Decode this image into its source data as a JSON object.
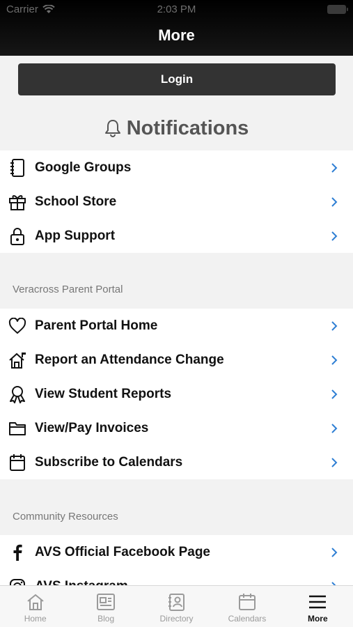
{
  "status_bar": {
    "carrier": "Carrier",
    "time": "2:03 PM"
  },
  "nav": {
    "title": "More"
  },
  "login_label": "Login",
  "notifications_label": "Notifications",
  "group1": [
    {
      "label": "Google Groups",
      "icon": "notebook-icon"
    },
    {
      "label": "School Store",
      "icon": "gift-icon"
    },
    {
      "label": "App Support",
      "icon": "lock-icon"
    }
  ],
  "section_veracross": "Veracross Parent Portal",
  "group2": [
    {
      "label": "Parent Portal Home",
      "icon": "heart-icon"
    },
    {
      "label": "Report an Attendance Change",
      "icon": "house-flag-icon"
    },
    {
      "label": "View Student Reports",
      "icon": "ribbon-icon"
    },
    {
      "label": "View/Pay Invoices",
      "icon": "folder-icon"
    },
    {
      "label": "Subscribe to Calendars",
      "icon": "calendar-icon"
    }
  ],
  "section_community": "Community Resources",
  "group3": [
    {
      "label": "AVS Official Facebook Page",
      "icon": "facebook-icon"
    },
    {
      "label": "AVS Instagram",
      "icon": "instagram-icon"
    }
  ],
  "tabs": [
    {
      "label": "Home",
      "icon": "home-icon"
    },
    {
      "label": "Blog",
      "icon": "blog-icon"
    },
    {
      "label": "Directory",
      "icon": "directory-icon"
    },
    {
      "label": "Calendars",
      "icon": "calendar-icon"
    },
    {
      "label": "More",
      "icon": "menu-icon",
      "active": true
    }
  ],
  "colors": {
    "chevron": "#2f7fd4",
    "bar": "#000000",
    "button": "#333333"
  }
}
